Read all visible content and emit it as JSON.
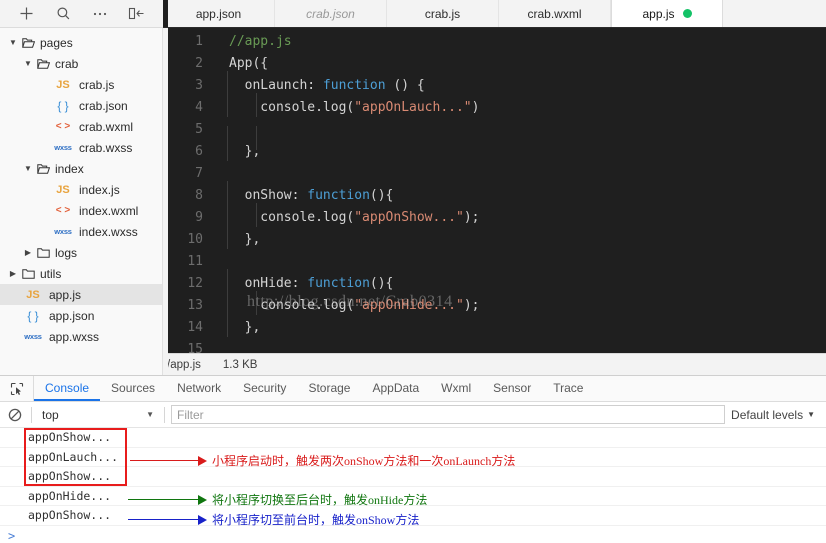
{
  "toolbar": {
    "icons": [
      {
        "name": "add-icon",
        "title": "Add"
      },
      {
        "name": "search-icon",
        "title": "Search"
      },
      {
        "name": "more-icon",
        "title": "More"
      },
      {
        "name": "collapse-panel-icon",
        "title": "Collapse panel"
      }
    ]
  },
  "editor_tabs": [
    {
      "label": "app.json",
      "state": "normal"
    },
    {
      "label": "crab.json",
      "state": "preview"
    },
    {
      "label": "crab.js",
      "state": "normal"
    },
    {
      "label": "crab.wxml",
      "state": "normal"
    },
    {
      "label": "app.js",
      "state": "active",
      "dot": true
    }
  ],
  "file_tree": [
    {
      "label": "pages",
      "depth": 0,
      "type": "folder",
      "caret": "open",
      "icon": "folder-open-icon"
    },
    {
      "label": "crab",
      "depth": 1,
      "type": "folder",
      "caret": "open",
      "icon": "folder-open-icon"
    },
    {
      "label": "crab.js",
      "depth": 2,
      "type": "file",
      "icon": "js-file-icon",
      "badge": "JS"
    },
    {
      "label": "crab.json",
      "depth": 2,
      "type": "file",
      "icon": "json-file-icon",
      "badge": "{ }"
    },
    {
      "label": "crab.wxml",
      "depth": 2,
      "type": "file",
      "icon": "wxml-file-icon",
      "badge": "< >"
    },
    {
      "label": "crab.wxss",
      "depth": 2,
      "type": "file",
      "icon": "wxss-file-icon",
      "badge": "wxss"
    },
    {
      "label": "index",
      "depth": 1,
      "type": "folder",
      "caret": "open",
      "icon": "folder-open-icon"
    },
    {
      "label": "index.js",
      "depth": 2,
      "type": "file",
      "icon": "js-file-icon",
      "badge": "JS"
    },
    {
      "label": "index.wxml",
      "depth": 2,
      "type": "file",
      "icon": "wxml-file-icon",
      "badge": "< >"
    },
    {
      "label": "index.wxss",
      "depth": 2,
      "type": "file",
      "icon": "wxss-file-icon",
      "badge": "wxss"
    },
    {
      "label": "logs",
      "depth": 1,
      "type": "folder",
      "caret": "closed",
      "icon": "folder-icon"
    },
    {
      "label": "utils",
      "depth": 0,
      "type": "folder",
      "caret": "closed",
      "icon": "folder-icon"
    },
    {
      "label": "app.js",
      "depth": 0,
      "type": "file",
      "icon": "js-file-icon",
      "badge": "JS",
      "selected": true
    },
    {
      "label": "app.json",
      "depth": 0,
      "type": "file",
      "icon": "json-file-icon",
      "badge": "{ }"
    },
    {
      "label": "app.wxss",
      "depth": 0,
      "type": "file",
      "icon": "wxss-file-icon",
      "badge": "wxss"
    }
  ],
  "code": {
    "lines": [
      {
        "n": "1",
        "tokens": [
          {
            "t": "//app.js",
            "c": "com"
          }
        ],
        "indent": 0
      },
      {
        "n": "2",
        "tokens": [
          {
            "t": "App({",
            "c": "pl"
          }
        ],
        "indent": 0
      },
      {
        "n": "3",
        "tokens": [
          {
            "t": "  onLaunch: ",
            "c": "pl"
          },
          {
            "t": "function",
            "c": "kw"
          },
          {
            "t": " () {",
            "c": "pl"
          }
        ],
        "indent": 1
      },
      {
        "n": "4",
        "tokens": [
          {
            "t": "    console.log(",
            "c": "pl"
          },
          {
            "t": "\"appOnLauch...\"",
            "c": "str"
          },
          {
            "t": ")",
            "c": "pl"
          }
        ],
        "indent": 2
      },
      {
        "n": "5",
        "tokens": [],
        "indent": 2
      },
      {
        "n": "6",
        "tokens": [
          {
            "t": "  },",
            "c": "pl"
          }
        ],
        "indent": 1
      },
      {
        "n": "7",
        "tokens": [],
        "indent": 0
      },
      {
        "n": "8",
        "tokens": [
          {
            "t": "  onShow: ",
            "c": "pl"
          },
          {
            "t": "function",
            "c": "kw"
          },
          {
            "t": "(){",
            "c": "pl"
          }
        ],
        "indent": 1
      },
      {
        "n": "9",
        "tokens": [
          {
            "t": "    console.log(",
            "c": "pl"
          },
          {
            "t": "\"appOnShow...\"",
            "c": "str"
          },
          {
            "t": ");",
            "c": "pl"
          }
        ],
        "indent": 2
      },
      {
        "n": "10",
        "tokens": [
          {
            "t": "  },",
            "c": "pl"
          }
        ],
        "indent": 1
      },
      {
        "n": "11",
        "tokens": [],
        "indent": 0
      },
      {
        "n": "12",
        "tokens": [
          {
            "t": "  onHide: ",
            "c": "pl"
          },
          {
            "t": "function",
            "c": "kw"
          },
          {
            "t": "(){",
            "c": "pl"
          }
        ],
        "indent": 1
      },
      {
        "n": "13",
        "tokens": [
          {
            "t": "    console.log(",
            "c": "pl"
          },
          {
            "t": "\"appOnHide...\"",
            "c": "str"
          },
          {
            "t": ");",
            "c": "pl"
          }
        ],
        "indent": 2
      },
      {
        "n": "14",
        "tokens": [
          {
            "t": "  },",
            "c": "pl"
          }
        ],
        "indent": 1
      },
      {
        "n": "15",
        "tokens": [],
        "indent": 0
      }
    ],
    "watermark": "http://blog.csdn.net/Crab0314"
  },
  "editor_status": {
    "path": "/app.js",
    "size": "1.3 KB"
  },
  "devtools": {
    "tabs": [
      {
        "label": "Console",
        "active": true
      },
      {
        "label": "Sources",
        "active": false
      },
      {
        "label": "Network",
        "active": false
      },
      {
        "label": "Security",
        "active": false
      },
      {
        "label": "Storage",
        "active": false
      },
      {
        "label": "AppData",
        "active": false
      },
      {
        "label": "Wxml",
        "active": false
      },
      {
        "label": "Sensor",
        "active": false
      },
      {
        "label": "Trace",
        "active": false
      }
    ],
    "console_toolbar": {
      "context": "top",
      "filter_placeholder": "Filter",
      "filter_value": "",
      "levels": "Default levels"
    },
    "messages": [
      "appOnShow...",
      "appOnLauch...",
      "appOnShow...",
      "appOnHide...",
      "appOnShow..."
    ],
    "prompt": ">"
  },
  "annotations": [
    {
      "color": "#d91b1b",
      "text": "小程序启动时，触发两次onShow方法和一次onLaunch方法"
    },
    {
      "color": "#10760f",
      "text": "将小程序切换至后台时，触发onHide方法"
    },
    {
      "color": "#1822c9",
      "text": "将小程序切至前台时，触发onShow方法"
    }
  ],
  "colors": {
    "active_tab_dot": "#14c267",
    "devtools_accent": "#1a73e8",
    "editor_bg": "#1f1f1f",
    "comment": "#699b55",
    "keyword": "#4d9fd6",
    "string": "#d98a73"
  }
}
